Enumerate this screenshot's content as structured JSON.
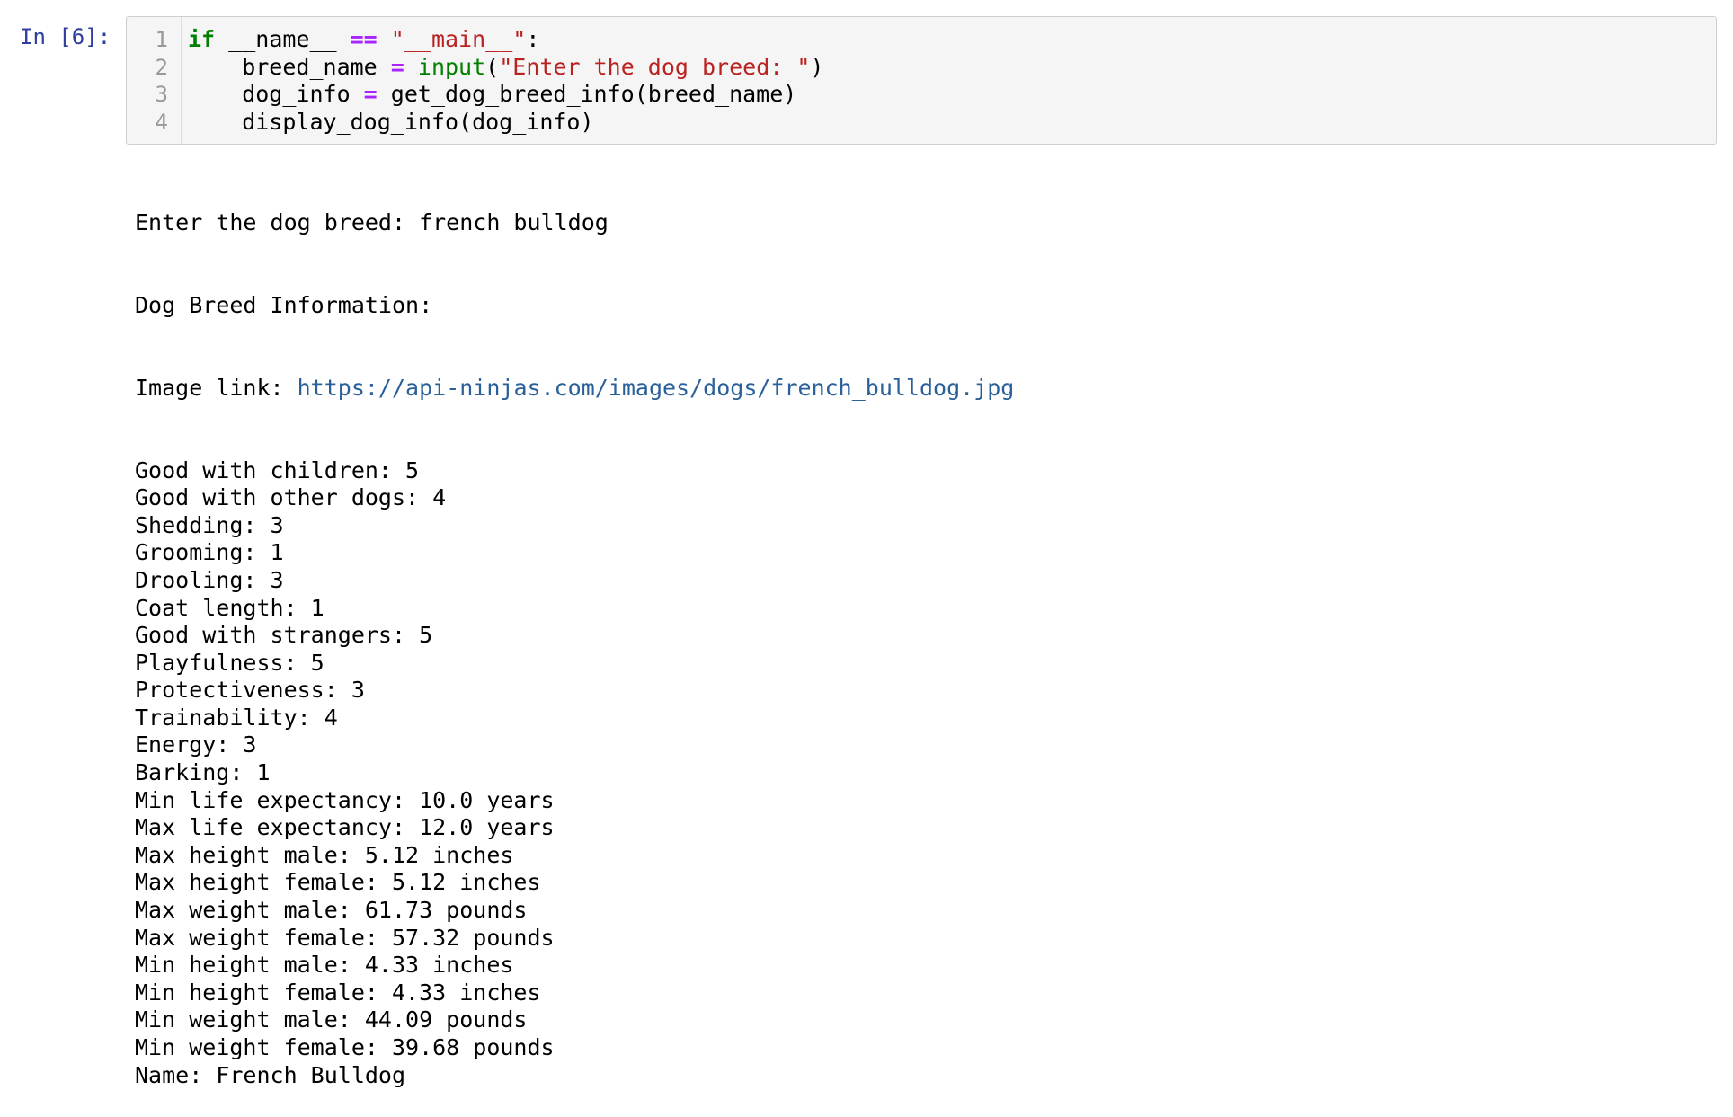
{
  "prompt": "In [6]:",
  "code": {
    "line_numbers": [
      "1",
      "2",
      "3",
      "4"
    ],
    "line1": {
      "kw": "if",
      "name": " __name__ ",
      "op": "==",
      "str": " \"__main__\"",
      "end": ":"
    },
    "line2": {
      "indent": "    breed_name ",
      "op": "=",
      "sp": " ",
      "builtin": "input",
      "open": "(",
      "str": "\"Enter the dog breed: \"",
      "close": ")"
    },
    "line3": {
      "indent": "    dog_info ",
      "op": "=",
      "rest": " get_dog_breed_info(breed_name)"
    },
    "line4": "    display_dog_info(dog_info)"
  },
  "output": {
    "lines_before_link": [
      "Enter the dog breed: french bulldog",
      "Dog Breed Information:"
    ],
    "image_label": "Image link: ",
    "image_link": "https://api-ninjas.com/images/dogs/french_bulldog.jpg",
    "lines": [
      "Good with children: 5",
      "Good with other dogs: 4",
      "Shedding: 3",
      "Grooming: 1",
      "Drooling: 3",
      "Coat length: 1",
      "Good with strangers: 5",
      "Playfulness: 5",
      "Protectiveness: 3",
      "Trainability: 4",
      "Energy: 3",
      "Barking: 1",
      "Min life expectancy: 10.0 years",
      "Max life expectancy: 12.0 years",
      "Max height male: 5.12 inches",
      "Max height female: 5.12 inches",
      "Max weight male: 61.73 pounds",
      "Max weight female: 57.32 pounds",
      "Min height male: 4.33 inches",
      "Min height female: 4.33 inches",
      "Min weight male: 44.09 pounds",
      "Min weight female: 39.68 pounds",
      "Name: French Bulldog"
    ]
  }
}
